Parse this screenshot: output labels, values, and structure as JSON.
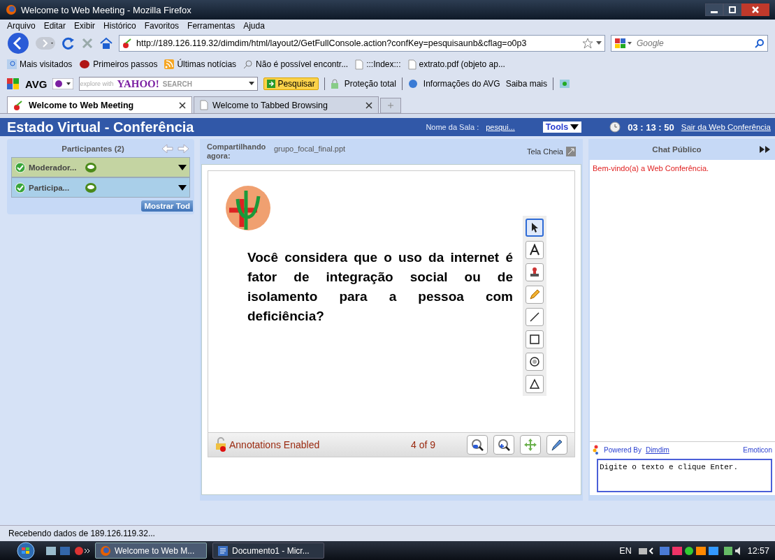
{
  "window": {
    "title": "Welcome to Web Meeting - Mozilla Firefox"
  },
  "menu": [
    "Arquivo",
    "Editar",
    "Exibir",
    "Histórico",
    "Favoritos",
    "Ferramentas",
    "Ajuda"
  ],
  "address": {
    "url": "http://189.126.119.32/dimdim/html/layout2/GetFullConsole.action?confKey=pesquisaunb&cflag=o0p3",
    "search_placeholder": "Google"
  },
  "bookmarks": [
    {
      "kind": "feed",
      "label": "Mais visitados"
    },
    {
      "kind": "bug",
      "label": "Primeiros passos"
    },
    {
      "kind": "rss",
      "label": "Últimas notícias"
    },
    {
      "kind": "search",
      "label": "Não é possível encontr..."
    },
    {
      "kind": "page",
      "label": ":::Index:::"
    },
    {
      "kind": "page",
      "label": "extrato.pdf (objeto ap..."
    }
  ],
  "avg_toolbar": {
    "brand": "AVG",
    "search_hint": "explore with",
    "search_brand": "YAHOO!",
    "search_word": "SEARCH",
    "button": "Pesquisar",
    "items": [
      "Proteção total",
      "Informações do AVG",
      "Saiba mais"
    ]
  },
  "tabs": [
    {
      "label": "Welcome to Web Meeting",
      "selected": true
    },
    {
      "label": "Welcome to Tabbed Browsing",
      "selected": false
    }
  ],
  "app": {
    "title": "Estado Virtual - Conferência",
    "room_label": "Nome da Sala :",
    "room_name": "pesqui...",
    "tools": "Tools",
    "timer": "03 : 13 : 50",
    "exit": "Sair da Web Conferência"
  },
  "participants": {
    "title": "Participantes (2)",
    "items": [
      {
        "name": "Moderador...",
        "kind": "moderator"
      },
      {
        "name": "Participa...",
        "kind": "participant"
      }
    ],
    "show_all": "Mostrar Tod"
  },
  "presentation": {
    "label": "Compartilhando agora:",
    "file": "grupo_focal_final.ppt",
    "fullscreen": "Tela Cheia",
    "slide_text": "Você considera que o uso da internet é fator de integração social ou de isolamento para a pessoa com deficiência?",
    "tools": [
      {
        "kind": "pointer",
        "selected": true
      },
      {
        "kind": "text",
        "selected": false
      },
      {
        "kind": "stamp",
        "selected": false
      },
      {
        "kind": "pencil",
        "selected": false
      },
      {
        "kind": "line",
        "selected": false
      },
      {
        "kind": "rectangle",
        "selected": false
      },
      {
        "kind": "ellipse",
        "selected": false
      },
      {
        "kind": "triangle",
        "selected": false
      }
    ],
    "annotations": "Annotations Enabled",
    "page": "4 of 9"
  },
  "chat": {
    "title": "Chat Público",
    "messages": [
      "Bem-vindo(a) a Web Conferência."
    ],
    "powered": "Powered By",
    "powered_link": "Dimdim",
    "emoticon": "Emoticon",
    "placeholder": "Digite o texto e clique Enter."
  },
  "status_bar": "Recebendo dados de 189.126.119.32...",
  "taskbar": {
    "items": [
      {
        "label": "Welcome to Web M...",
        "selected": true
      },
      {
        "label": "Documento1 - Micr...",
        "selected": false
      }
    ],
    "lang": "EN",
    "time": "12:57"
  }
}
